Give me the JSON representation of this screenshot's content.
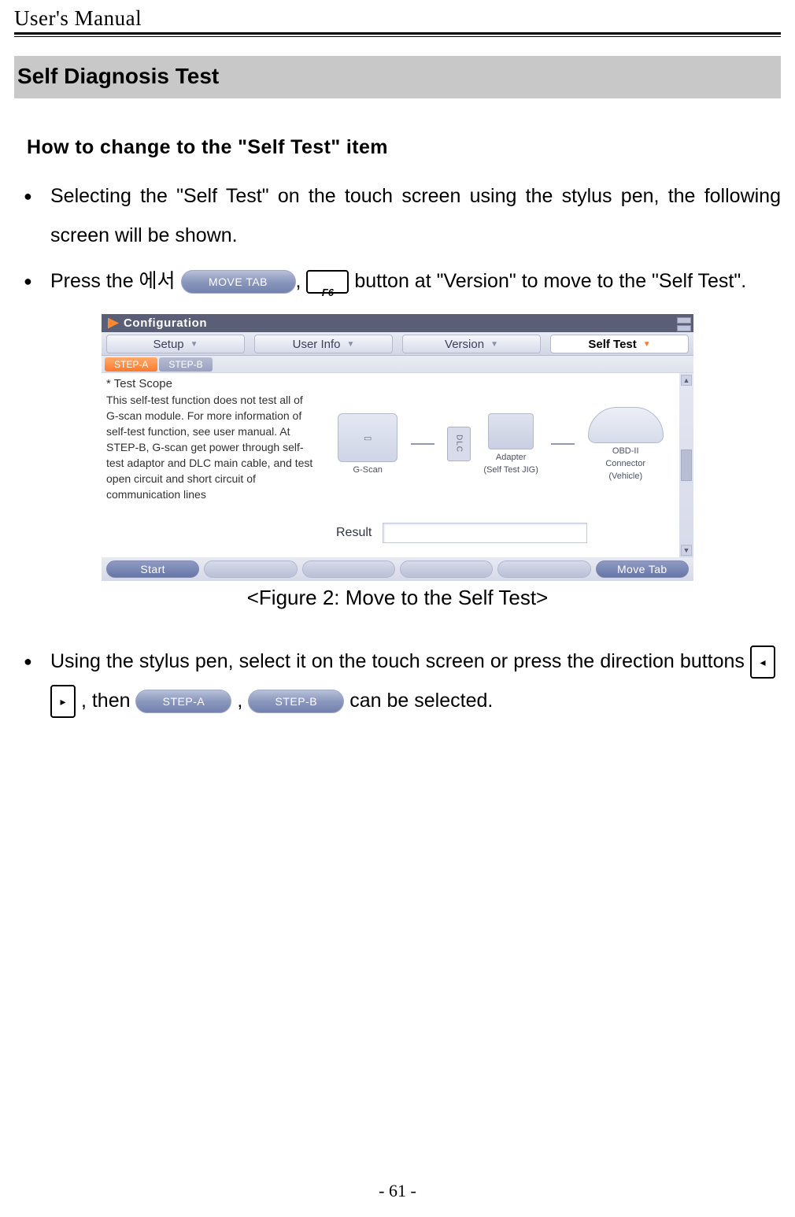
{
  "header": "User's Manual",
  "section_title": "Self Diagnosis Test",
  "subsection": "How to change to the \"Self Test\" item",
  "bullets": {
    "b1": "Selecting the \"Self Test\" on the touch screen using the stylus pen, the following screen will be shown.",
    "b2_pre": "Press the 에서 ",
    "b2_move": "MOVE TAB",
    "b2_sep": ", ",
    "b2_f6": "F6",
    "b2_post": " button at \"Version\" to move to the \"Self Test\".",
    "b3_pre": "Using the stylus pen, select it on the touch screen or press the direction buttons ",
    "b3_left": "◂",
    "b3_right": "▸",
    "b3_then": ", then ",
    "b3_stepA": "STEP-A",
    "b3_commaspace": ", ",
    "b3_stepB": "STEP-B",
    "b3_post": " can be selected."
  },
  "figure_caption": "<Figure 2: Move to the Self Test>",
  "screenshot": {
    "config_label": "Configuration",
    "tabs": {
      "setup": "Setup",
      "userinfo": "User Info",
      "version": "Version",
      "selftest": "Self Test"
    },
    "subtabs": {
      "a": "STEP-A",
      "b": "STEP-B"
    },
    "scope_title": "* Test Scope",
    "scope_text": "This self-test function does not test all of G-scan module. For more information of self-test function, see user manual. At STEP-B, G-scan get power through self-test adaptor and DLC main cable, and test open circuit and short circuit of communication lines",
    "labels": {
      "gscan": "G-Scan",
      "adapter1": "Adapter",
      "adapter2": "(Self Test JIG)",
      "dlc": "DLC",
      "obd1": "OBD-II",
      "obd2": "Connector",
      "obd3": "(Vehicle)"
    },
    "result_label": "Result",
    "footer": {
      "start": "Start",
      "move": "Move Tab"
    }
  },
  "page_number": "- 61 -"
}
